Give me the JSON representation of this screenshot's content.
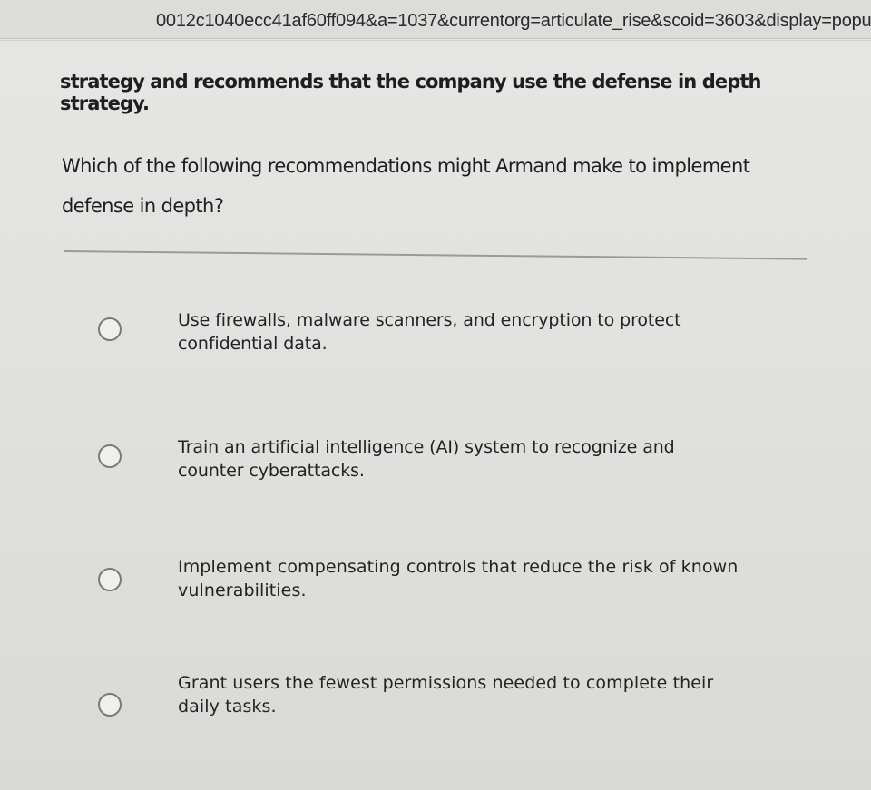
{
  "browser": {
    "url": "0012c1040ecc41af60ff094&a=1037&currentorg=articulate_rise&scoid=3603&display=popu"
  },
  "quiz": {
    "context": "strategy and recommends that the company use the defense in depth strategy.",
    "question": "Which of the following recommendations might Armand make to implement defense in depth?",
    "options": [
      {
        "label": "Use firewalls, malware scanners, and encryption to protect confidential data."
      },
      {
        "label": "Train an artificial intelligence (AI) system to recognize and counter cyberattacks."
      },
      {
        "label": "Implement compensating controls that reduce the risk of known vulnerabilities."
      },
      {
        "label": "Grant users the fewest permissions needed to complete their daily tasks."
      }
    ]
  }
}
